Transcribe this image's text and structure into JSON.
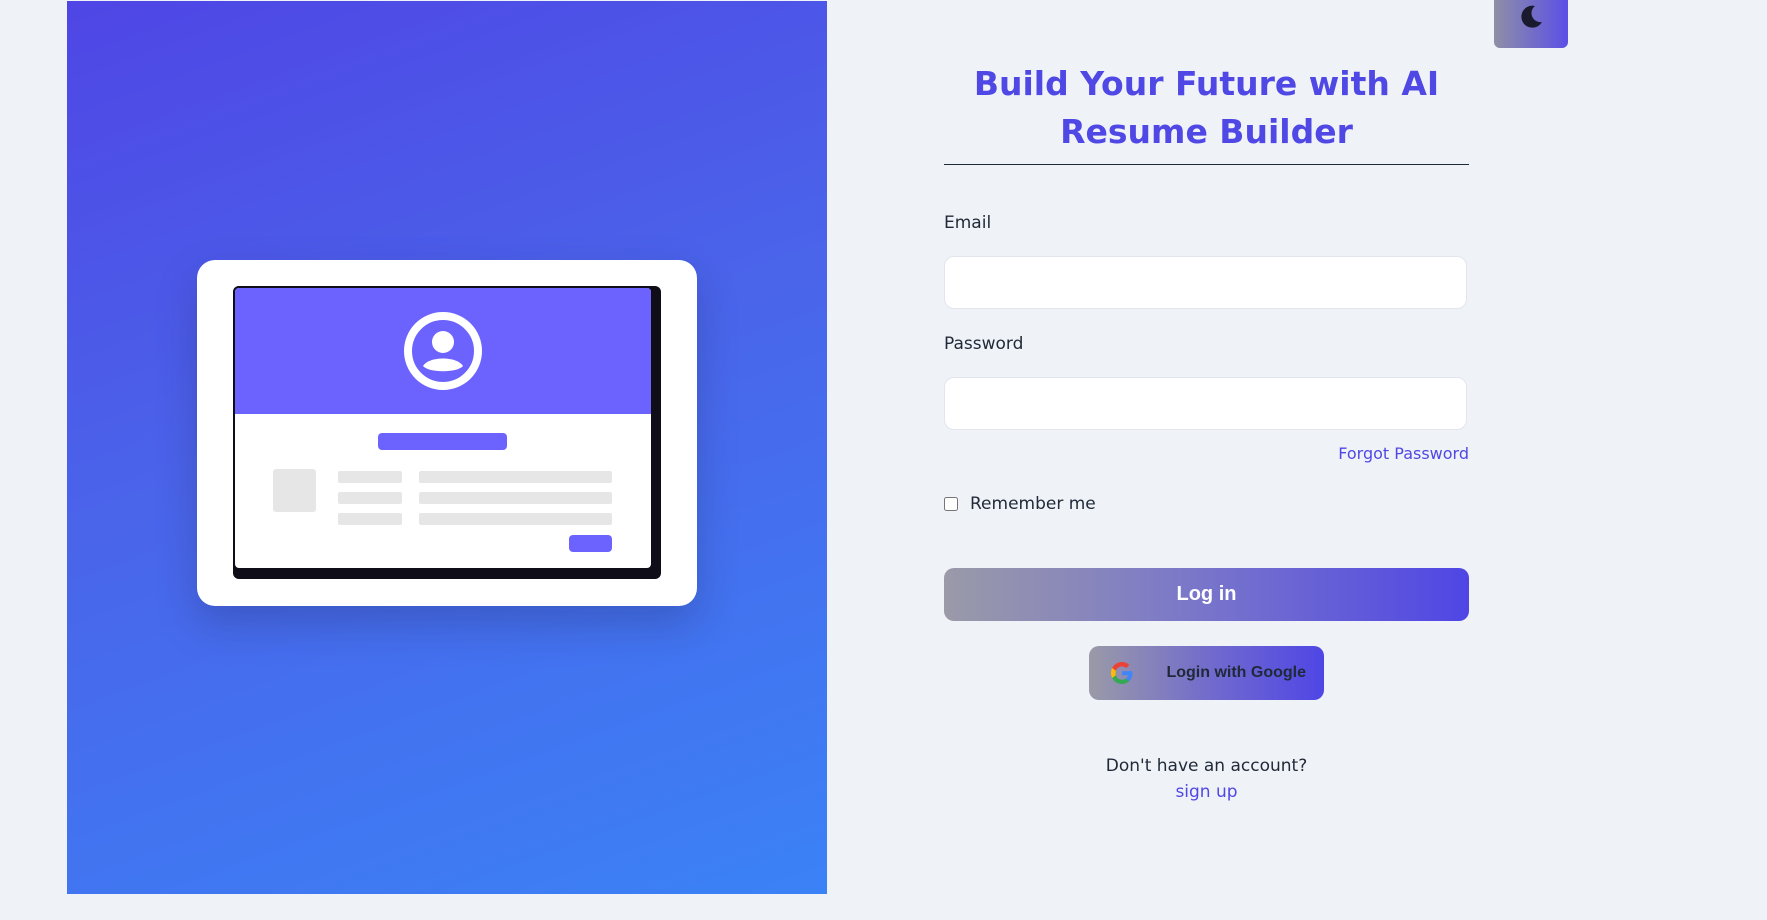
{
  "header": {
    "title": "Build Your Future with AI Resume Builder"
  },
  "theme_toggle": {
    "icon": "moon-icon"
  },
  "form": {
    "email_label": "Email",
    "email_value": "",
    "password_label": "Password",
    "password_value": "",
    "forgot_password": "Forgot Password",
    "remember_me": "Remember me",
    "login_button": "Log in",
    "google_button": "Login with Google",
    "no_account": "Don't have an account?",
    "signup_link": "sign up"
  },
  "colors": {
    "accent": "#5048e5",
    "hero_start": "#4f46e5",
    "hero_end": "#3b82f6",
    "illustration_accent": "#6c63ff",
    "background": "#eff2f7"
  }
}
